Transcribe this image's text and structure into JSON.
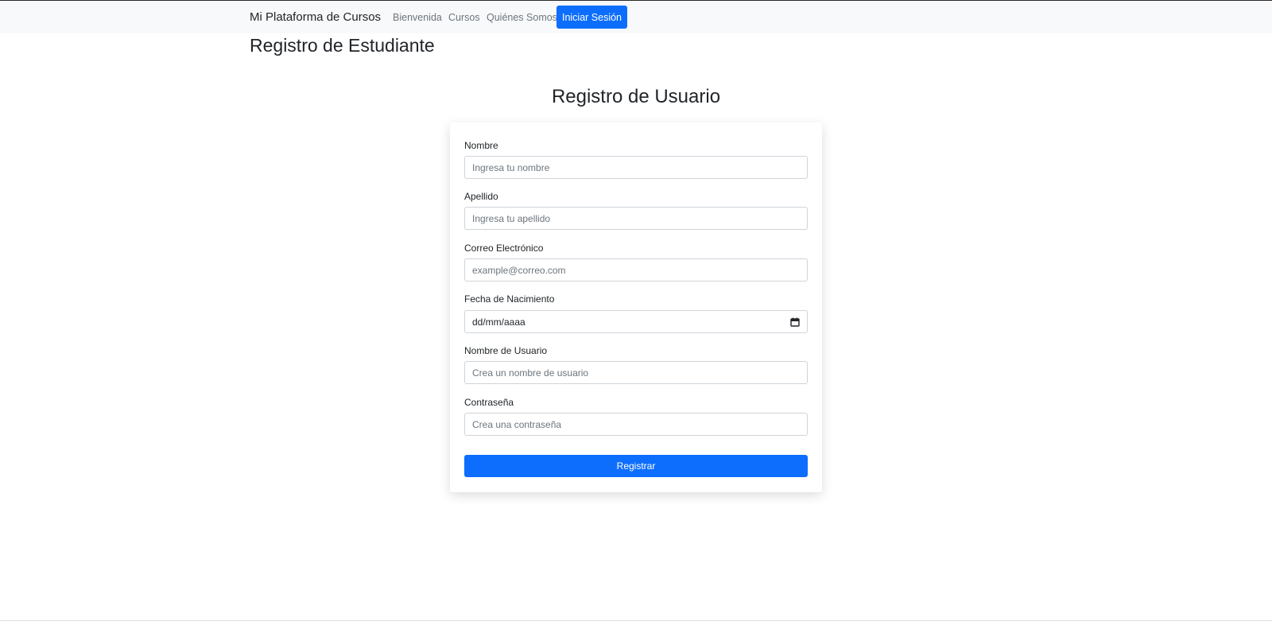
{
  "navbar": {
    "brand": "Mi Plataforma de Cursos",
    "links": [
      "Bienvenida",
      "Cursos",
      "Quiénes Somos"
    ],
    "login_button": "Iniciar Sesión"
  },
  "page_title": "Registro de Estudiante",
  "form": {
    "title": "Registro de Usuario",
    "fields": [
      {
        "label": "Nombre",
        "placeholder": "Ingresa tu nombre"
      },
      {
        "label": "Apellido",
        "placeholder": "Ingresa tu apellido"
      },
      {
        "label": "Correo Electrónico",
        "placeholder": "example@correo.com"
      },
      {
        "label": "Fecha de Nacimiento",
        "placeholder": "dd/mm/aaaa"
      },
      {
        "label": "Nombre de Usuario",
        "placeholder": "Crea un nombre de usuario"
      },
      {
        "label": "Contraseña",
        "placeholder": "Crea una contraseña"
      }
    ],
    "submit_label": "Registrar"
  },
  "icons": {
    "date_picker": "calendar-icon"
  },
  "colors": {
    "primary": "#0d6efd",
    "navbar_bg": "#f8f9fa",
    "muted_text": "#6c757d"
  }
}
